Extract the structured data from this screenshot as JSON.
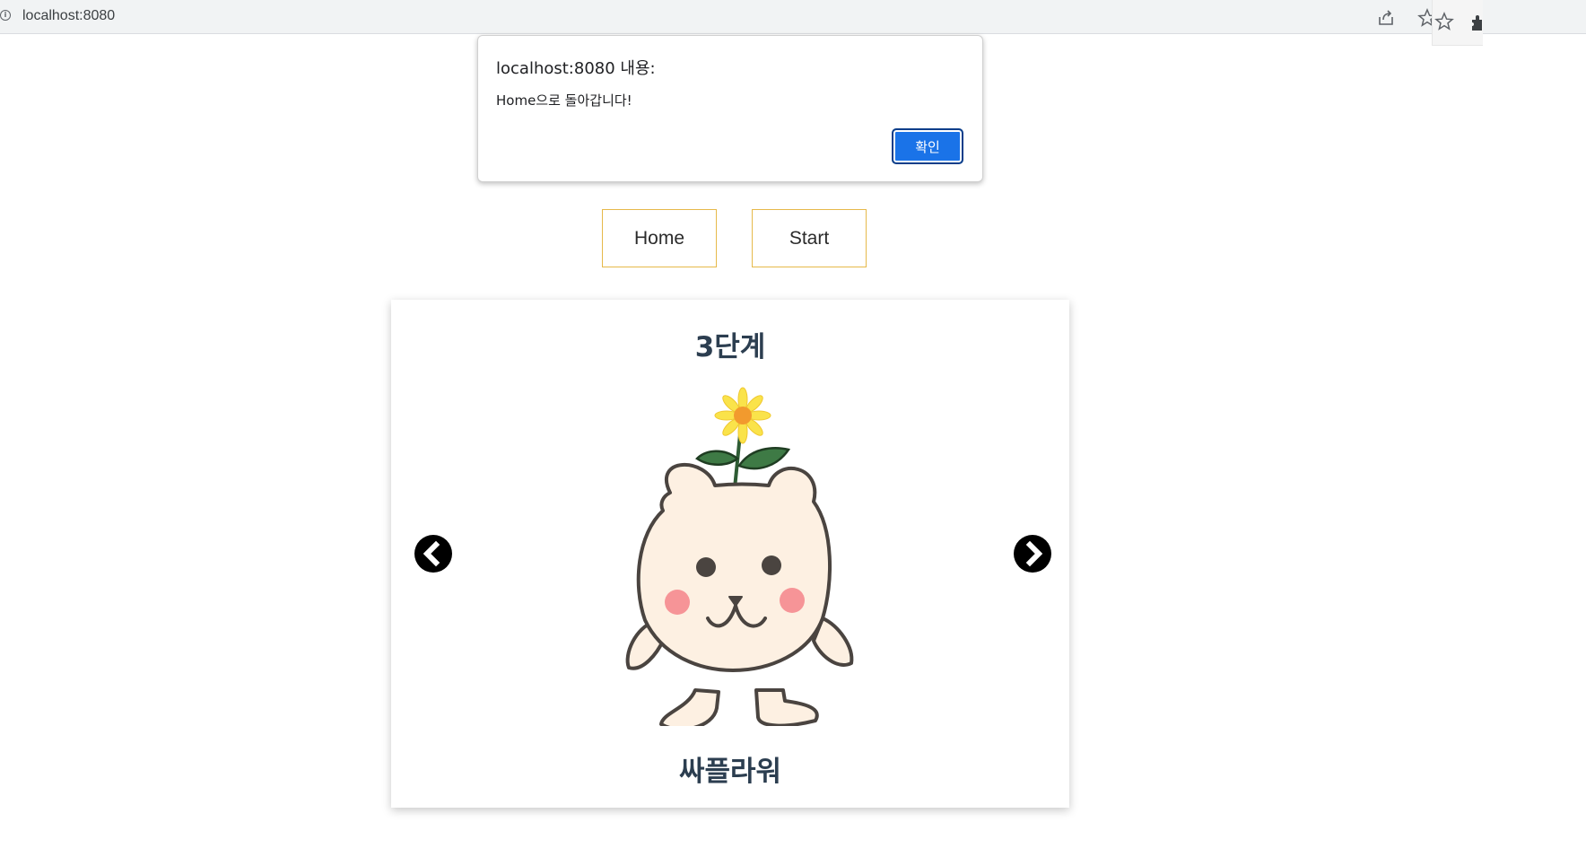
{
  "browser": {
    "url": "localhost:8080",
    "icons": [
      "info-icon",
      "share-icon",
      "star-icon",
      "extensions-icon"
    ]
  },
  "dialog": {
    "title": "localhost:8080 내용:",
    "message": "Home으로 돌아갑니다!",
    "ok_label": "확인"
  },
  "nav": {
    "home_label": "Home",
    "start_label": "Start"
  },
  "card": {
    "level": "3단계",
    "name": "싸플라워"
  },
  "colors": {
    "accent": "#1a73e8",
    "nav_border": "#e6b94a",
    "heading": "#2c3e50"
  }
}
